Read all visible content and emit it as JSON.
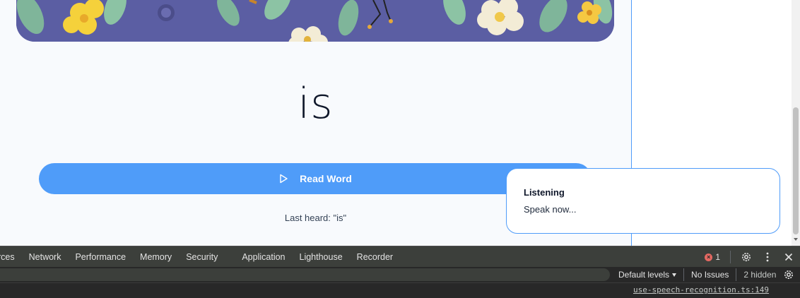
{
  "reading": {
    "current_word": "is",
    "read_button_label": "Read Word",
    "last_heard": "Last heard: \"is\""
  },
  "toast": {
    "title": "Listening",
    "description": "Speak now..."
  },
  "devtools": {
    "tabs": [
      "rces",
      "Network",
      "Performance",
      "Memory",
      "Security",
      "Application",
      "Lighthouse",
      "Recorder"
    ],
    "error_count": "1",
    "levels_label": "Default levels",
    "issues_label": "No Issues",
    "hidden_label": "2 hidden",
    "console_source_link": "use-speech-recognition.ts:149"
  },
  "colors": {
    "accent": "#4f9cf9",
    "illustration_bg": "#5b5ea3",
    "devtools_bg": "#282828",
    "error": "#e46962"
  },
  "icons": {
    "read_button": "play-icon",
    "devtools_settings": "gear-icon",
    "devtools_menu": "kebab-menu-icon",
    "devtools_close": "close-icon",
    "filter_settings": "gear-icon"
  }
}
